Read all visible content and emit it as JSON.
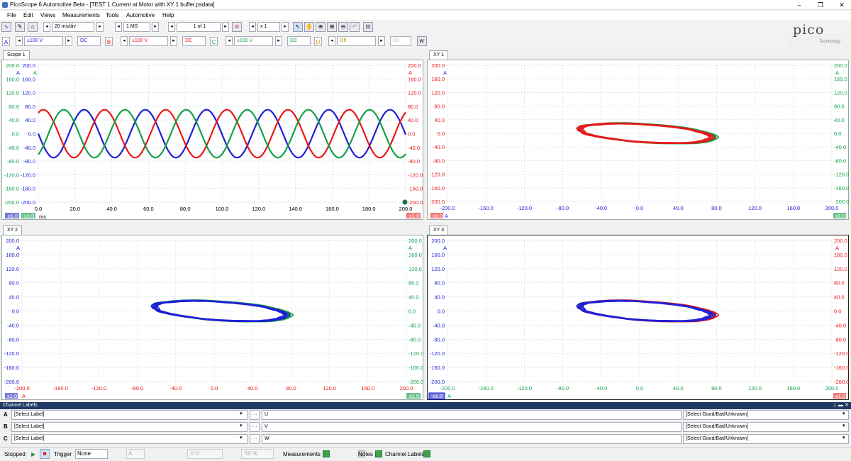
{
  "window": {
    "title": "PicoScope 6 Automotive Beta - [TEST 1 Current at Motor with XY 1 buffer.psdata]",
    "minimize": "–",
    "maximize": "❐",
    "close": "✕"
  },
  "menu": [
    "File",
    "Edit",
    "Views",
    "Measurements",
    "Tools",
    "Automotive",
    "Help"
  ],
  "toolbar": {
    "timebase": "20 ms/div",
    "samples": "1 MS",
    "buffer": "1 of 1",
    "zoom": "x 1",
    "range_a": "±100 V",
    "coupling_a": "DC",
    "range_b": "±100 V",
    "coupling_b": "DC",
    "range_c": "±100 V",
    "coupling_c": "DC",
    "range_d": "Off",
    "coupling_d": "DC"
  },
  "channel_letters": [
    "A",
    "B",
    "C",
    "D"
  ],
  "brand": {
    "logo": "pico",
    "sub": "Technology"
  },
  "colors": {
    "blue": "#1f1fd6",
    "red": "#e81818",
    "green": "#13a04a",
    "grid": "#c8dde8"
  },
  "views": {
    "scope1": {
      "tab": "Scope 1",
      "unit_left": "A",
      "unit_mid": "A",
      "unit_right": "A",
      "x_unit": "ms",
      "scale_left": "x1.0",
      "scale_mid": "x1.0",
      "scale_right": "x1.0"
    },
    "xy1": {
      "tab": "XY 1",
      "unit_left": "A",
      "unit_right": "A",
      "scale_left": "x1.0",
      "scale_right": "x1.0",
      "x_unit": "A"
    },
    "xy2": {
      "tab": "XY 2",
      "unit_left": "A",
      "unit_right": "A",
      "scale_left": "x1.0",
      "scale_right": "x1.0",
      "x_unit": "A"
    },
    "xy3": {
      "tab": "XY 3",
      "unit_left": "A",
      "unit_right": "A",
      "scale_left": "x1.0",
      "scale_right": "x1.0",
      "x_unit": "A"
    }
  },
  "y_ticks": [
    "200.0",
    "160.0",
    "120.0",
    "80.0",
    "40.0",
    "0.0",
    "-40.0",
    "-80.0",
    "-120.0",
    "-160.0",
    "-200.0"
  ],
  "scope_x_ticks": [
    "0.0",
    "20.0",
    "40.0",
    "60.0",
    "80.0",
    "100.0",
    "120.0",
    "140.0",
    "160.0",
    "180.0",
    "200.0"
  ],
  "xy_x_ticks": [
    "-200.0",
    "-160.0",
    "-120.0",
    "-80.0",
    "-40.0",
    "0.0",
    "40.0",
    "80.0",
    "120.0",
    "160.0",
    "200.0"
  ],
  "chart_data": [
    {
      "type": "line",
      "name": "Scope 1",
      "xlabel": "ms",
      "xlim": [
        0,
        200
      ],
      "ylim": [
        -200,
        200
      ],
      "series": [
        {
          "channel": "A",
          "color": "#1f1fd6",
          "amplitude": 70,
          "period_ms": 33.3,
          "phase_deg": 0
        },
        {
          "channel": "B",
          "color": "#e81818",
          "amplitude": 70,
          "period_ms": 33.3,
          "phase_deg": 240
        },
        {
          "channel": "C",
          "color": "#13a04a",
          "amplitude": 70,
          "period_ms": 33.3,
          "phase_deg": 120
        }
      ]
    },
    {
      "type": "scatter",
      "name": "XY 1",
      "xlim": [
        -200,
        200
      ],
      "ylim": [
        -200,
        200
      ],
      "series": [
        {
          "channel": "B vs A",
          "color": "#e81818"
        },
        {
          "channel": "C vs A",
          "color": "#13a04a"
        }
      ]
    },
    {
      "type": "scatter",
      "name": "XY 2",
      "xlim": [
        -200,
        200
      ],
      "ylim": [
        -200,
        200
      ],
      "series": [
        {
          "channel": "A vs B",
          "color": "#1f1fd6"
        },
        {
          "channel": "C vs B",
          "color": "#13a04a"
        }
      ]
    },
    {
      "type": "scatter",
      "name": "XY 3",
      "xlim": [
        -200,
        200
      ],
      "ylim": [
        -200,
        200
      ],
      "series": [
        {
          "channel": "A vs C",
          "color": "#1f1fd6"
        },
        {
          "channel": "B vs C",
          "color": "#e81818"
        }
      ]
    }
  ],
  "channel_labels": {
    "header": "Channel Labels",
    "rows": [
      {
        "letter": "A",
        "label": "[Select Label]",
        "value": "U",
        "good": "[Select Good/Bad/Unknown]"
      },
      {
        "letter": "B",
        "label": "[Select Label]",
        "value": "V",
        "good": "[Select Good/Bad/Unknown]"
      },
      {
        "letter": "C",
        "label": "[Select Label]",
        "value": "W",
        "good": "[Select Good/Bad/Unknown]"
      }
    ]
  },
  "status": {
    "state": "Stopped",
    "trigger_label": "Trigger",
    "trigger_mode": "None",
    "trigger_channel": "A",
    "trigger_level": "0 V",
    "trigger_pos": "50 %",
    "measurements": "Measurements",
    "notes": "Notes",
    "channel_labels": "Channel Labels"
  }
}
